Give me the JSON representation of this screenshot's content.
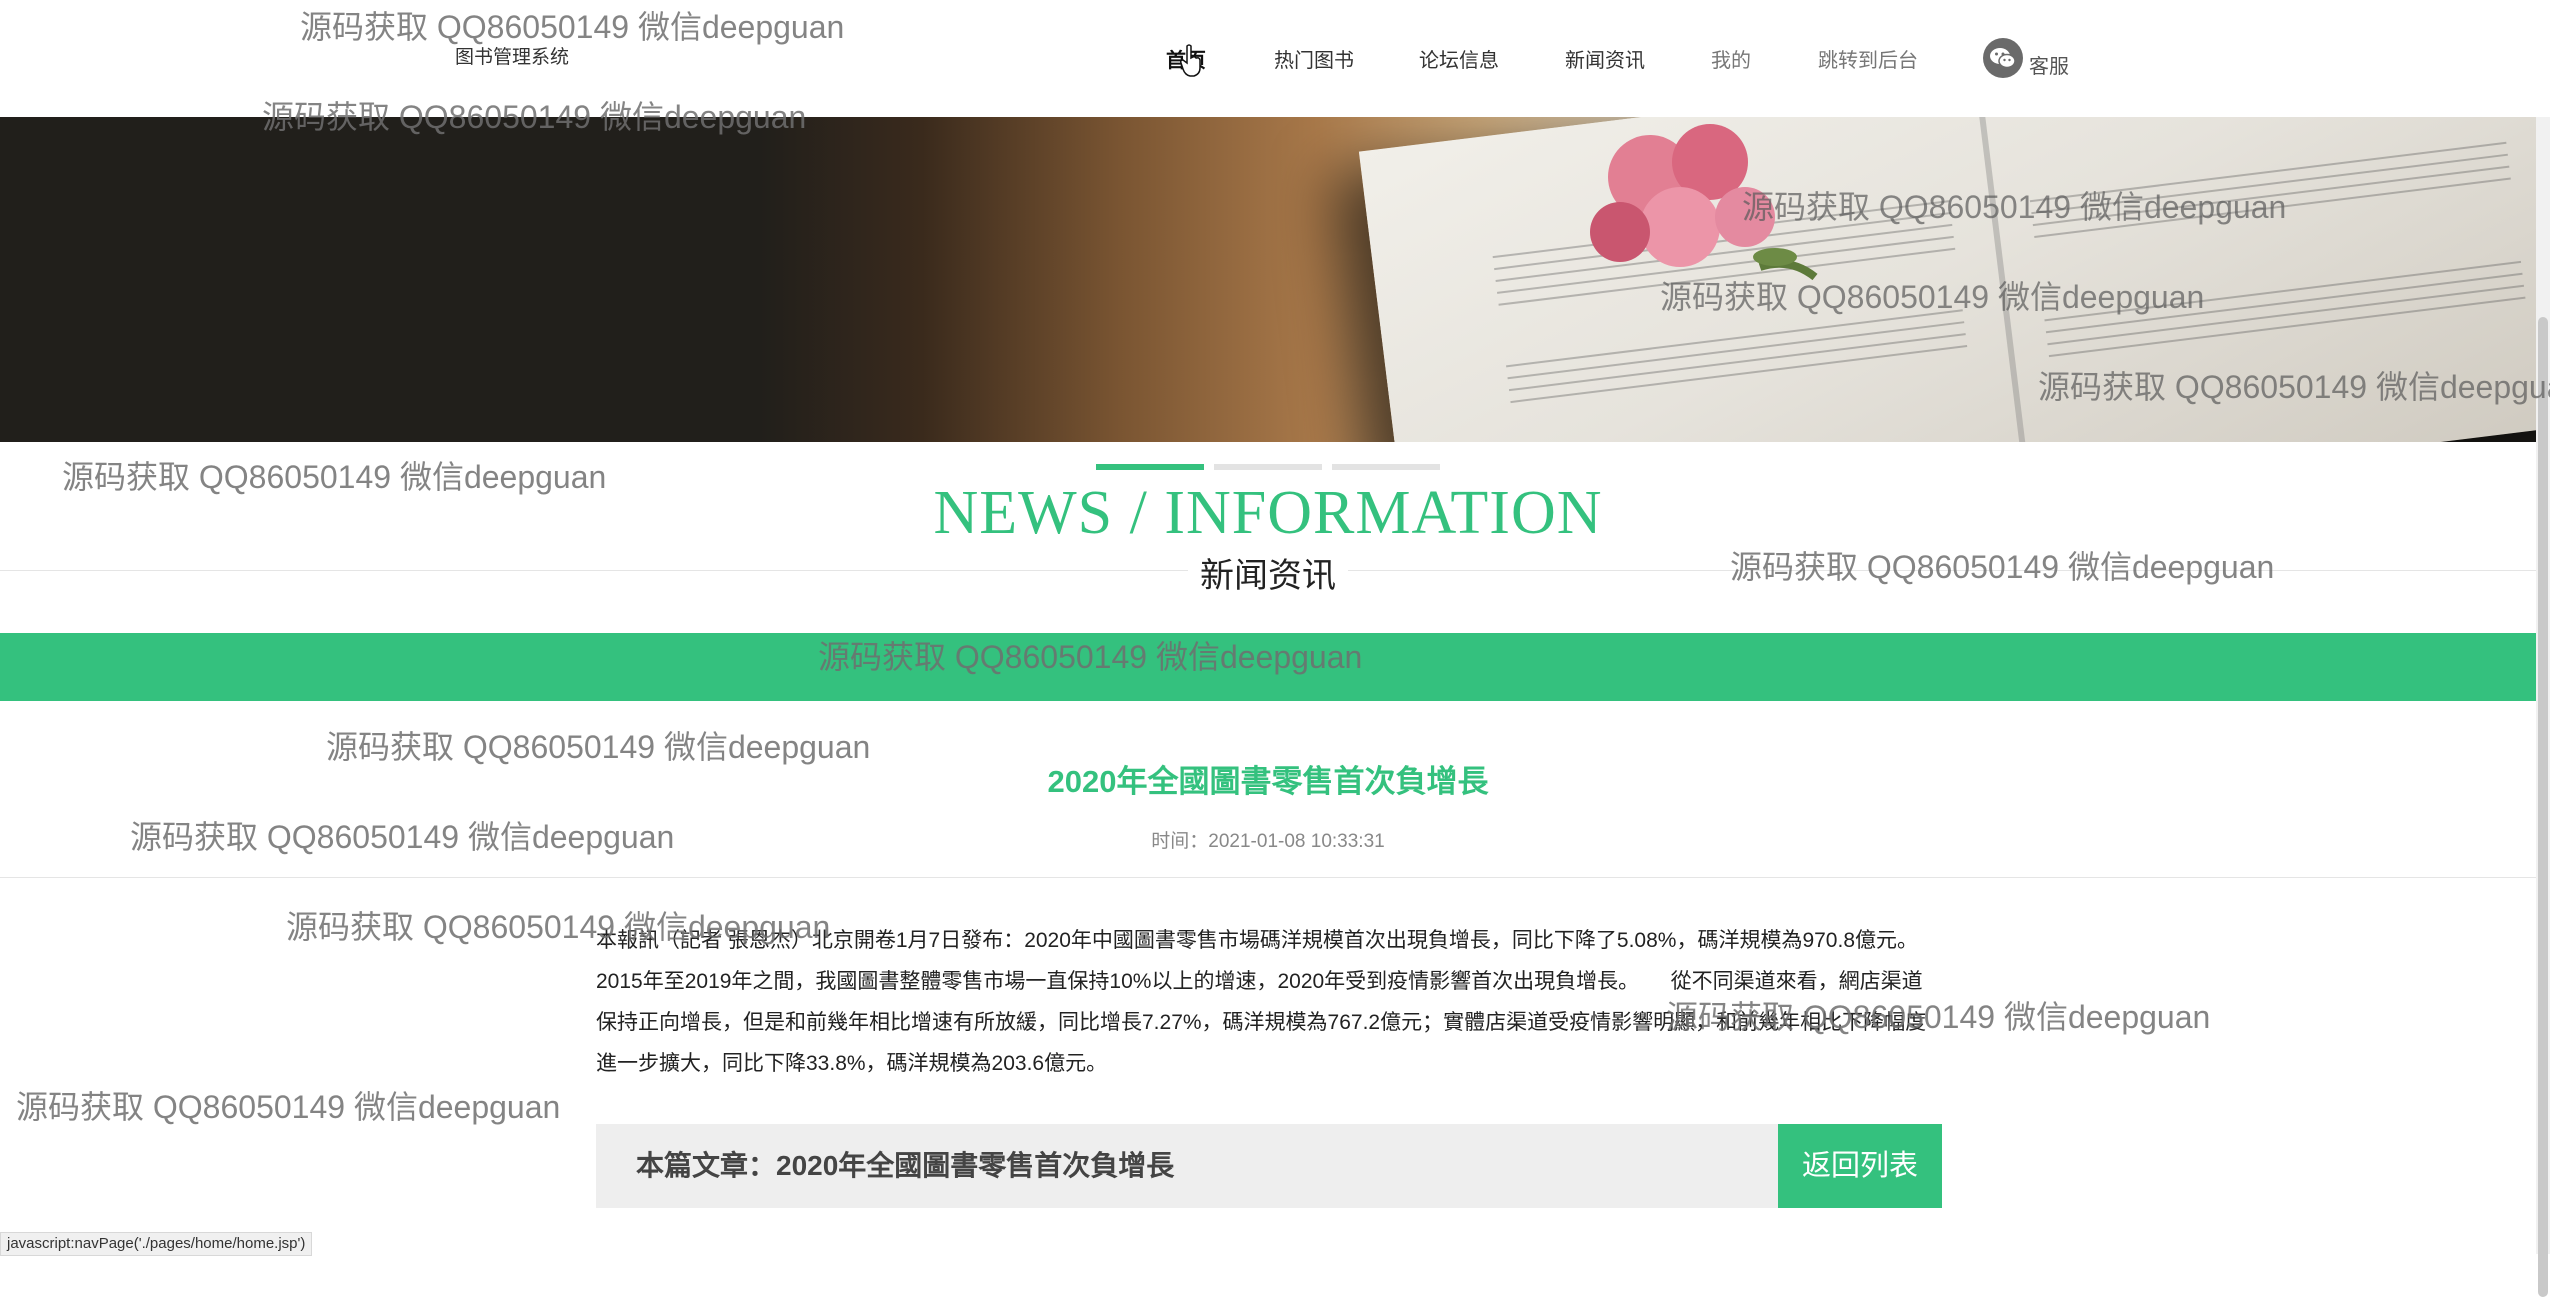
{
  "header": {
    "brand": "图书管理系统",
    "nav": [
      {
        "label": "首页"
      },
      {
        "label": "热门图书"
      },
      {
        "label": "论坛信息"
      },
      {
        "label": "新闻资讯"
      },
      {
        "label": "我的"
      },
      {
        "label": "跳转到后台"
      }
    ],
    "customer_service": "客服"
  },
  "section": {
    "title_en": "NEWS / INFORMATION",
    "title_cn": "新闻资讯"
  },
  "article": {
    "title": "2020年全國圖書零售首次負增長",
    "time": "时间：2021-01-08 10:33:31",
    "body": "本報訊（記者 張恩杰）北京開卷1月7日發布：2020年中國圖書零售市場碼洋規模首次出現負增長，同比下降了5.08%，碼洋規模為970.8億元。2015年至2019年之間，我國圖書整體零售市場一直保持10%以上的增速，2020年受到疫情影響首次出現負增長。　　從不同渠道來看，網店渠道保持正向增長，但是和前幾年相比增速有所放緩，同比增長7.27%，碼洋規模為767.2億元；實體店渠道受疫情影響明顯，和前幾年相比下降幅度進一步擴大，同比下降33.8%，碼洋規模為203.6億元。",
    "footer_label": "本篇文章：2020年全國圖書零售首次負增長",
    "back_button": "返回列表"
  },
  "status_bar": "javascript:navPage('./pages/home/home.jsp')",
  "watermark": "源码获取 QQ86050149 微信deepguan",
  "colors": {
    "accent": "#34c17e"
  }
}
